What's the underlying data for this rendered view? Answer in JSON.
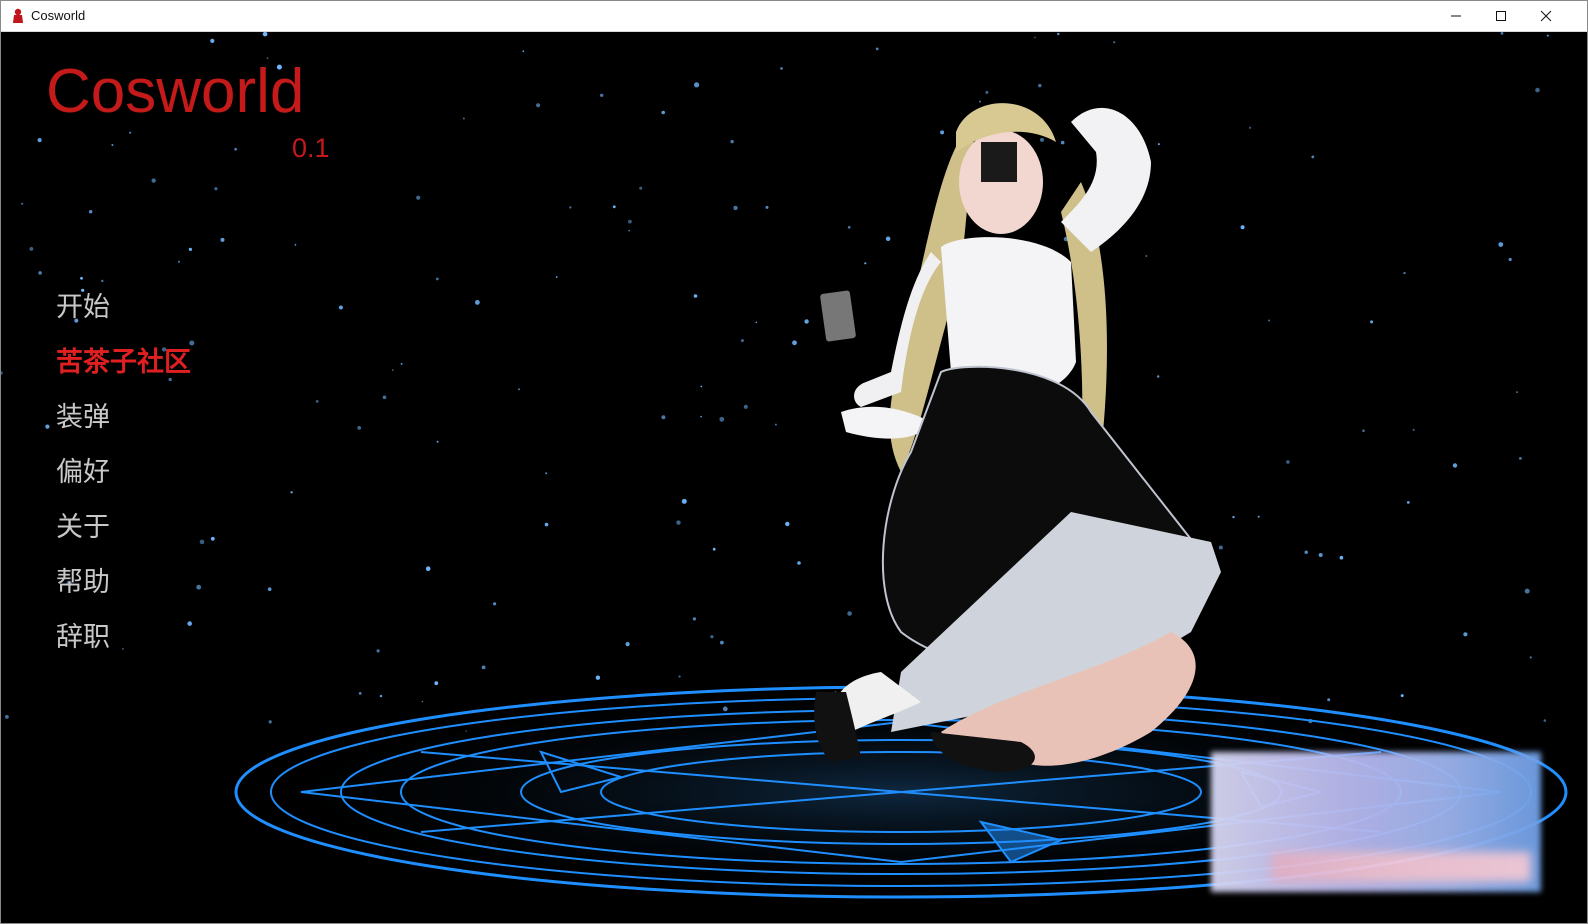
{
  "window": {
    "title": "Cosworld"
  },
  "game": {
    "title": "Cosworld",
    "version": "0.1"
  },
  "menu": {
    "items": [
      {
        "label": "开始",
        "active": false
      },
      {
        "label": "苦茶子社区",
        "active": true
      },
      {
        "label": "装弹",
        "active": false
      },
      {
        "label": "偏好",
        "active": false
      },
      {
        "label": "关于",
        "active": false
      },
      {
        "label": "帮助",
        "active": false
      },
      {
        "label": "辞职",
        "active": false
      }
    ]
  },
  "colors": {
    "title_red": "#c41a1a",
    "menu_idle": "#c8c8c8",
    "menu_active": "#e02020",
    "circle_blue": "#1f8fff"
  },
  "icons": {
    "app": "red-figure-icon",
    "minimize": "minimize-icon",
    "maximize": "maximize-icon",
    "close": "close-icon"
  }
}
